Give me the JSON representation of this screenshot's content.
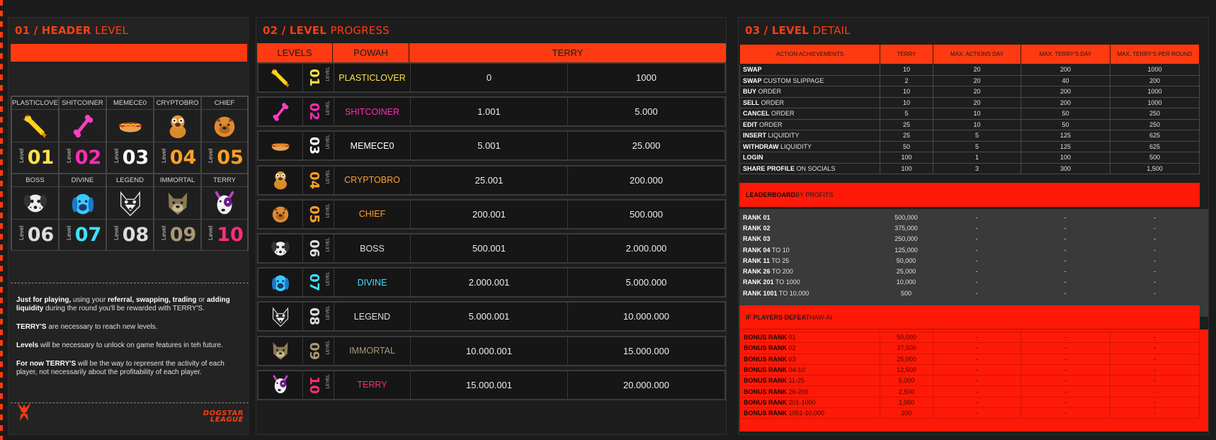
{
  "colors": {
    "accent": "#ff3a10",
    "leaderboard": "#ff1a08"
  },
  "panel1": {
    "title_bold": "01 / HEADER",
    "title_thin": "LEVEL",
    "level_word": "Level",
    "levels": [
      {
        "name": "PLASTICLOVER",
        "num": "01",
        "color": "#ffe14a",
        "icon": "rubber-chicken-icon"
      },
      {
        "name": "SHITCOINER",
        "num": "02",
        "color": "#ff2db4",
        "icon": "bone-icon"
      },
      {
        "name": "MEMECE0",
        "num": "03",
        "color": "#ffffff",
        "icon": "hotdog-icon"
      },
      {
        "name": "CRYPTOBRO",
        "num": "04",
        "color": "#ff9f2a",
        "icon": "pug-icon"
      },
      {
        "name": "CHIEF",
        "num": "05",
        "color": "#ff9f2a",
        "icon": "bulldog-face-icon"
      },
      {
        "name": "BOSS",
        "num": "06",
        "color": "#dddddd",
        "icon": "dalmatian-icon"
      },
      {
        "name": "DIVINE",
        "num": "07",
        "color": "#3ee0ff",
        "icon": "blue-dog-icon"
      },
      {
        "name": "LEGEND",
        "num": "08",
        "color": "#dddddd",
        "icon": "wolf-icon"
      },
      {
        "name": "IMMORTAL",
        "num": "09",
        "color": "#a89a72",
        "icon": "khaki-dog-icon"
      },
      {
        "name": "TERRY",
        "num": "10",
        "color": "#ff2d7a",
        "icon": "bull-terrier-icon"
      }
    ],
    "info": {
      "p1": {
        "b1": "Just for playing,",
        "t1": " using your ",
        "b2": "referral, swapping, trading",
        "t2": " or ",
        "b3": "adding liquidity",
        "t3": " during the round you'll be rewarded with TERRY'S."
      },
      "p2": {
        "b1": "TERRY'S",
        "t1": " are necessary to reach new levels."
      },
      "p3": {
        "b1": "Levels",
        "t1": " will be necessary to unlock on game features in teh future."
      },
      "p4": {
        "b1": "For now TERRY'S",
        "t1": " will be the way to represent the activity of each player, not necessarily about the profitability of each player."
      }
    },
    "brand_line1": "DOGSTAR",
    "brand_line2": "LEAGUE"
  },
  "panel2": {
    "title_bold": "02 / LEVEL",
    "title_thin": "PROGRESS",
    "headers": [
      "LEVELS",
      "POWAH",
      "TERRY"
    ],
    "level_word": "LEVEL",
    "rows": [
      {
        "num": "01",
        "name": "PLASTICLOVER",
        "from": "0",
        "to": "1000"
      },
      {
        "num": "02",
        "name": "SHITCOINER",
        "from": "1.001",
        "to": "5.000"
      },
      {
        "num": "03",
        "name": "MEMECE0",
        "from": "5.001",
        "to": "25.000"
      },
      {
        "num": "04",
        "name": "CRYPTOBRO",
        "from": "25.001",
        "to": "200.000"
      },
      {
        "num": "05",
        "name": "CHIEF",
        "from": "200.001",
        "to": "500.000"
      },
      {
        "num": "06",
        "name": "BOSS",
        "from": "500.001",
        "to": "2.000.000"
      },
      {
        "num": "07",
        "name": "DIVINE",
        "from": "2.000.001",
        "to": "5.000.000"
      },
      {
        "num": "08",
        "name": "LEGEND",
        "from": "5.000.001",
        "to": "10.000.000"
      },
      {
        "num": "09",
        "name": "IMMORTAL",
        "from": "10.000.001",
        "to": "15.000.000"
      },
      {
        "num": "10",
        "name": "TERRY",
        "from": "15.000.001",
        "to": "20.000.000"
      }
    ]
  },
  "panel3": {
    "title_bold": "03 / LEVEL",
    "title_thin": "DETAIL",
    "headers": [
      "ACTION ACHIEVEMENTS",
      "TERRY",
      "MAX. ACTIONS DAY",
      "MAX. TERRY'S DAY",
      "MAX. TERRY'S PER ROUND"
    ],
    "actions": [
      {
        "b": "SWAP",
        "t": "",
        "v": [
          "10",
          "20",
          "200",
          "1000"
        ]
      },
      {
        "b": "SWAP",
        "t": " CUSTOM SLIPPAGE",
        "v": [
          "2",
          "20",
          "40",
          "200"
        ]
      },
      {
        "b": "BUY",
        "t": " ORDER",
        "v": [
          "10",
          "20",
          "200",
          "1000"
        ]
      },
      {
        "b": "SELL",
        "t": " ORDER",
        "v": [
          "10",
          "20",
          "200",
          "1000"
        ]
      },
      {
        "b": "CANCEL",
        "t": " ORDER",
        "v": [
          "5",
          "10",
          "50",
          "250"
        ]
      },
      {
        "b": "EDIT",
        "t": " ORDER",
        "v": [
          "25",
          "10",
          "50",
          "250"
        ]
      },
      {
        "b": "INSERT",
        "t": " LIQUIDITY",
        "v": [
          "25",
          "5",
          "125",
          "625"
        ]
      },
      {
        "b": "WITHDRAW",
        "t": " LIQUIDITY",
        "v": [
          "50",
          "5",
          "125",
          "625"
        ]
      },
      {
        "b": "LOGIN",
        "t": "",
        "v": [
          "100",
          "1",
          "100",
          "500"
        ]
      },
      {
        "b": "SHARE PROFILE",
        "t": " ON SOCIALS",
        "v": [
          "100",
          "3",
          "300",
          "1,500"
        ]
      }
    ],
    "leaderboard": {
      "title_bold": "LEADERBOARD",
      "title_thin": " BY PROFITS",
      "rows": [
        {
          "b": "RANK 01",
          "t": "",
          "v": [
            "500,000",
            "-",
            "-",
            "-"
          ]
        },
        {
          "b": "RANK 02",
          "t": "",
          "v": [
            "375,000",
            "-",
            "-",
            "-"
          ]
        },
        {
          "b": "RANK 03",
          "t": "",
          "v": [
            "250,000",
            "-",
            "-",
            "-"
          ]
        },
        {
          "b": "RANK 04",
          "t": " TO 10",
          "v": [
            "125,000",
            "-",
            "-",
            "-"
          ]
        },
        {
          "b": "RANK 11",
          "t": " TO 25",
          "v": [
            "50,000",
            "-",
            "-",
            "-"
          ]
        },
        {
          "b": "RANK 26",
          "t": " TO 200",
          "v": [
            "25,000",
            "-",
            "-",
            "-"
          ]
        },
        {
          "b": "RANK 201",
          "t": " TO 1000",
          "v": [
            "10,000",
            "-",
            "-",
            "-"
          ]
        },
        {
          "b": "RANK 1001",
          "t": " TO 10,000",
          "v": [
            "500",
            "-",
            "-",
            "-"
          ]
        }
      ]
    },
    "bonus": {
      "title_bold": "IF PLAYERS DEFEAT",
      "title_thin": " HAW-AI",
      "rows": [
        {
          "b": "BONUS RANK",
          "t": " 01",
          "v": [
            "50,000",
            "-",
            "-",
            "-"
          ]
        },
        {
          "b": "BONUS RANK",
          "t": " 02",
          "v": [
            "37,500",
            "-",
            "-",
            "-"
          ]
        },
        {
          "b": "BONUS RANK",
          "t": " 03",
          "v": [
            "25,000",
            "-",
            "-",
            "-"
          ]
        },
        {
          "b": "BONUS RANK",
          "t": " 04-10",
          "v": [
            "12,500",
            "-",
            "-",
            "-"
          ]
        },
        {
          "b": "BONUS RANK",
          "t": " 11-25",
          "v": [
            "5,000",
            "-",
            "-",
            "-"
          ]
        },
        {
          "b": "BONUS RANK",
          "t": " 26-200",
          "v": [
            "2,500",
            "-",
            "-",
            "-"
          ]
        },
        {
          "b": "BONUS RANK",
          "t": " 201-1000",
          "v": [
            "1,000",
            "-",
            "-",
            "-"
          ]
        },
        {
          "b": "BONUS RANK",
          "t": " 1001-10,000",
          "v": [
            "200",
            "-",
            "-",
            "-"
          ]
        }
      ]
    }
  }
}
